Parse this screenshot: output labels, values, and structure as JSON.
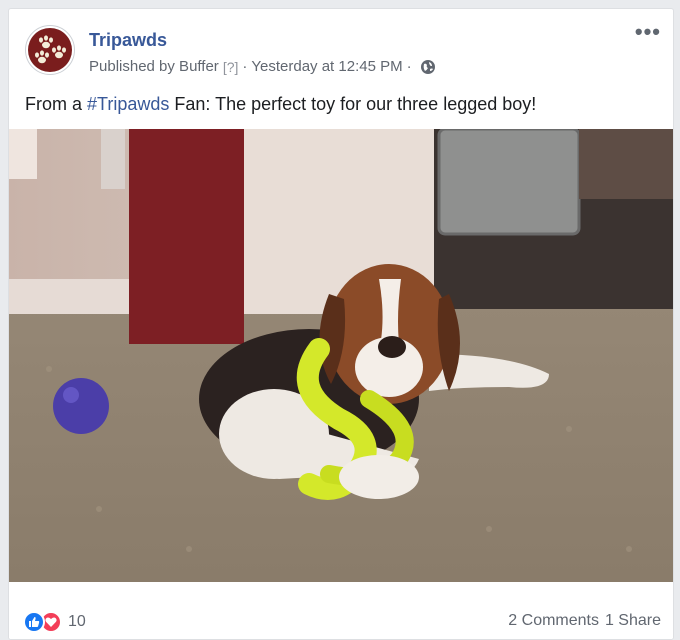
{
  "post": {
    "page_name": "Tripawds",
    "published_by": "Published by Buffer",
    "help_marker": "[?]",
    "separator": "·",
    "timestamp": "Yesterday at 12:45 PM",
    "privacy_icon": "globe-icon",
    "more_icon": "more-options-icon",
    "more_label": "•••",
    "caption_prefix": "From a ",
    "caption_hashtag": "#Tripawds",
    "caption_suffix": " Fan: The perfect toy for our three legged boy!",
    "photo_icon": "dog-with-toy-photo"
  },
  "footer": {
    "reaction_icons": [
      "like-icon",
      "love-icon"
    ],
    "reaction_count": "10",
    "comments": "2 Comments",
    "shares": "1 Share"
  },
  "colors": {
    "link": "#385898",
    "like": "#1877f2",
    "love": "#f33e58",
    "muted": "#616770",
    "avatar_bg": "#7a1d1d"
  }
}
